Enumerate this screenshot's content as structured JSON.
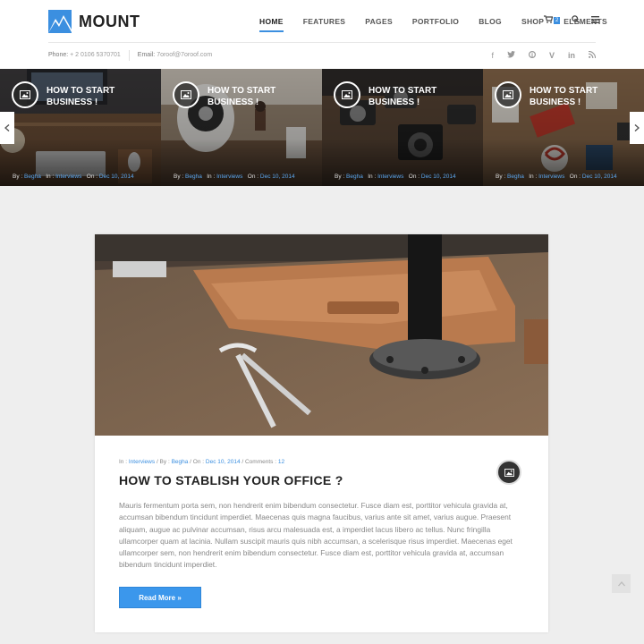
{
  "brand": {
    "name": "MOUNT",
    "logo_icon": "mountain-logo-icon",
    "accent": "#3b8fe0"
  },
  "nav": {
    "items": [
      {
        "label": "HOME",
        "active": true
      },
      {
        "label": "FEATURES"
      },
      {
        "label": "PAGES"
      },
      {
        "label": "PORTFOLIO"
      },
      {
        "label": "BLOG"
      },
      {
        "label": "SHOP"
      },
      {
        "label": "ELEMENTS"
      }
    ],
    "cart_count": "2",
    "icons": [
      "cart-icon",
      "search-icon",
      "menu-icon"
    ]
  },
  "topbar": {
    "phone_label": "Phone:",
    "phone": "+ 2 0106 5370701",
    "email_label": "Email:",
    "email": "7oroof@7oroof.com",
    "socials": [
      "facebook-icon",
      "twitter-icon",
      "pinterest-icon",
      "vimeo-icon",
      "linkedin-icon",
      "rss-icon"
    ]
  },
  "slider": {
    "slides": [
      {
        "title_line1": "HOW TO START",
        "title_line2": "BUSINESS !",
        "by_label": "By :",
        "author": "Begha",
        "in_label": "In :",
        "category": "Interviews",
        "on_label": "On :",
        "date": "Dec 10, 2014"
      },
      {
        "title_line1": "HOW TO START",
        "title_line2": "BUSINESS !",
        "by_label": "By :",
        "author": "Begha",
        "in_label": "In :",
        "category": "Interviews",
        "on_label": "On :",
        "date": "Dec 10, 2014"
      },
      {
        "title_line1": "HOW TO START",
        "title_line2": "BUSINESS !",
        "by_label": "By :",
        "author": "Begha",
        "in_label": "In :",
        "category": "Interviews",
        "on_label": "On :",
        "date": "Dec 10, 2014"
      },
      {
        "title_line1": "HOW TO START",
        "title_line2": "BUSINESS !",
        "by_label": "By :",
        "author": "Begha",
        "in_label": "In :",
        "category": "Interviews",
        "on_label": "On :",
        "date": "Dec 10, 2014"
      }
    ],
    "prev_icon": "chevron-left-icon",
    "next_icon": "chevron-right-icon"
  },
  "post": {
    "meta": {
      "in_label": "In :",
      "category": "Interviews",
      "by_label": "/ By :",
      "author": "Begha",
      "on_label": "/ On :",
      "date": "Dec 10, 2014",
      "comments_label": "/ Comments :",
      "comments": "12"
    },
    "title": "HOW TO STABLISH YOUR OFFICE ?",
    "body": "Mauris fermentum porta sem, non hendrerit enim bibendum consectetur. Fusce diam est, porttitor vehicula gravida at, accumsan bibendum tincidunt imperdiet. Maecenas quis magna faucibus, varius ante sit amet, varius augue. Praesent aliquam, augue ac pulvinar accumsan, risus arcu malesuada est, a imperdiet lacus libero ac tellus. Nunc fringilla ullamcorper quam at lacinia. Nullam suscipit mauris quis nibh accumsan, a scelerisque risus imperdiet. Maecenas eget ullamcorper sem, non hendrerit enim bibendum consectetur. Fusce diam est, porttitor vehicula gravida at, accumsan bibendum tincidunt imperdiet.",
    "read_more": "Read More »",
    "format_icon": "image-icon"
  },
  "back_to_top_icon": "chevron-up-icon"
}
